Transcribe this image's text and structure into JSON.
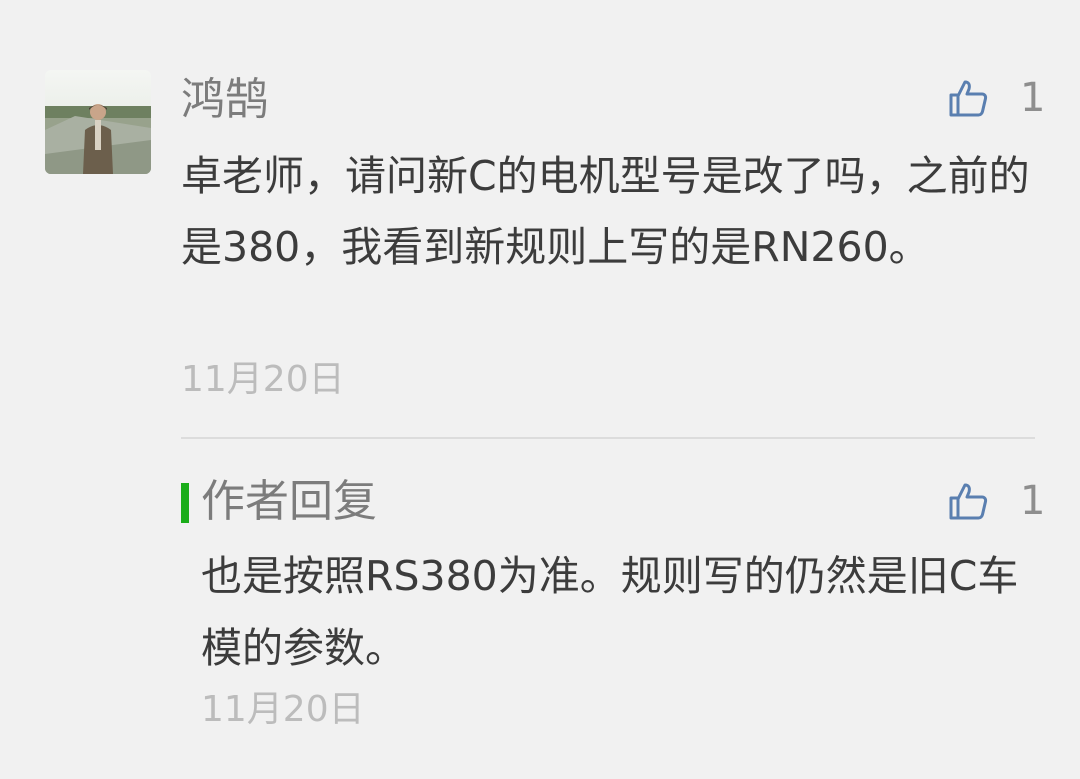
{
  "comment": {
    "nickname": "鸿鹄",
    "avatar_icon": "user-photo-avatar",
    "like_icon": "thumbs-up-icon",
    "like_count": "1",
    "text": "卓老师，请问新C的电机型号是改了吗，之前的是380，我看到新规则上写的是RN260。",
    "date": "11月20日"
  },
  "reply": {
    "title": "作者回复",
    "accent_color": "#1aad19",
    "like_icon": "thumbs-up-icon",
    "like_count": "1",
    "text": "也是按照RS380为准。规则写的仍然是旧C车模的参数。",
    "date": "11月20日"
  },
  "colors": {
    "background": "#f1f1f1",
    "body_text": "#3c3c3c",
    "muted_text": "#7c7c7c",
    "timestamp_text": "#bcbcbc",
    "like_icon": "#5a7fb0",
    "divider": "#dcdcdc"
  }
}
